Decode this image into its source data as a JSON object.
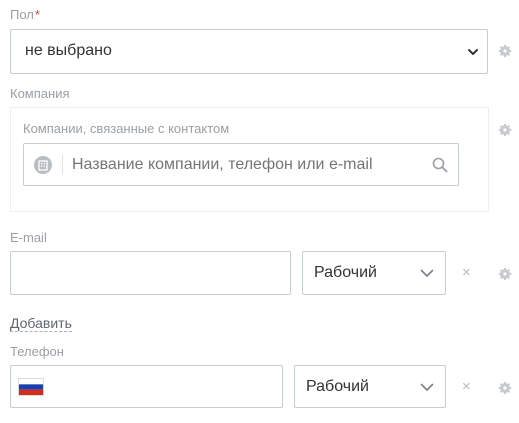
{
  "gender": {
    "label": "Пол",
    "required_mark": "*",
    "selected": "не выбрано"
  },
  "company": {
    "label": "Компания",
    "related_label": "Компании, связанные с контактом",
    "search_placeholder": "Название компании, телефон или e-mail"
  },
  "email": {
    "label": "E-mail",
    "value": "",
    "type_selected": "Рабочий",
    "add_link": "Добавить"
  },
  "phone": {
    "label": "Телефон",
    "value": "",
    "country": "russia",
    "type_selected": "Рабочий"
  },
  "icons": {
    "settings": "gear-icon",
    "remove": "close-icon",
    "dropdown": "chevron-down-icon",
    "search": "search-icon",
    "company": "building-icon",
    "flag": "russia-flag-icon"
  },
  "colors": {
    "label_gray": "#9aa0a6",
    "required_red": "#e0433b",
    "border": "#c6cdd3",
    "text": "#333333"
  },
  "glyphs": {
    "close": "×"
  }
}
